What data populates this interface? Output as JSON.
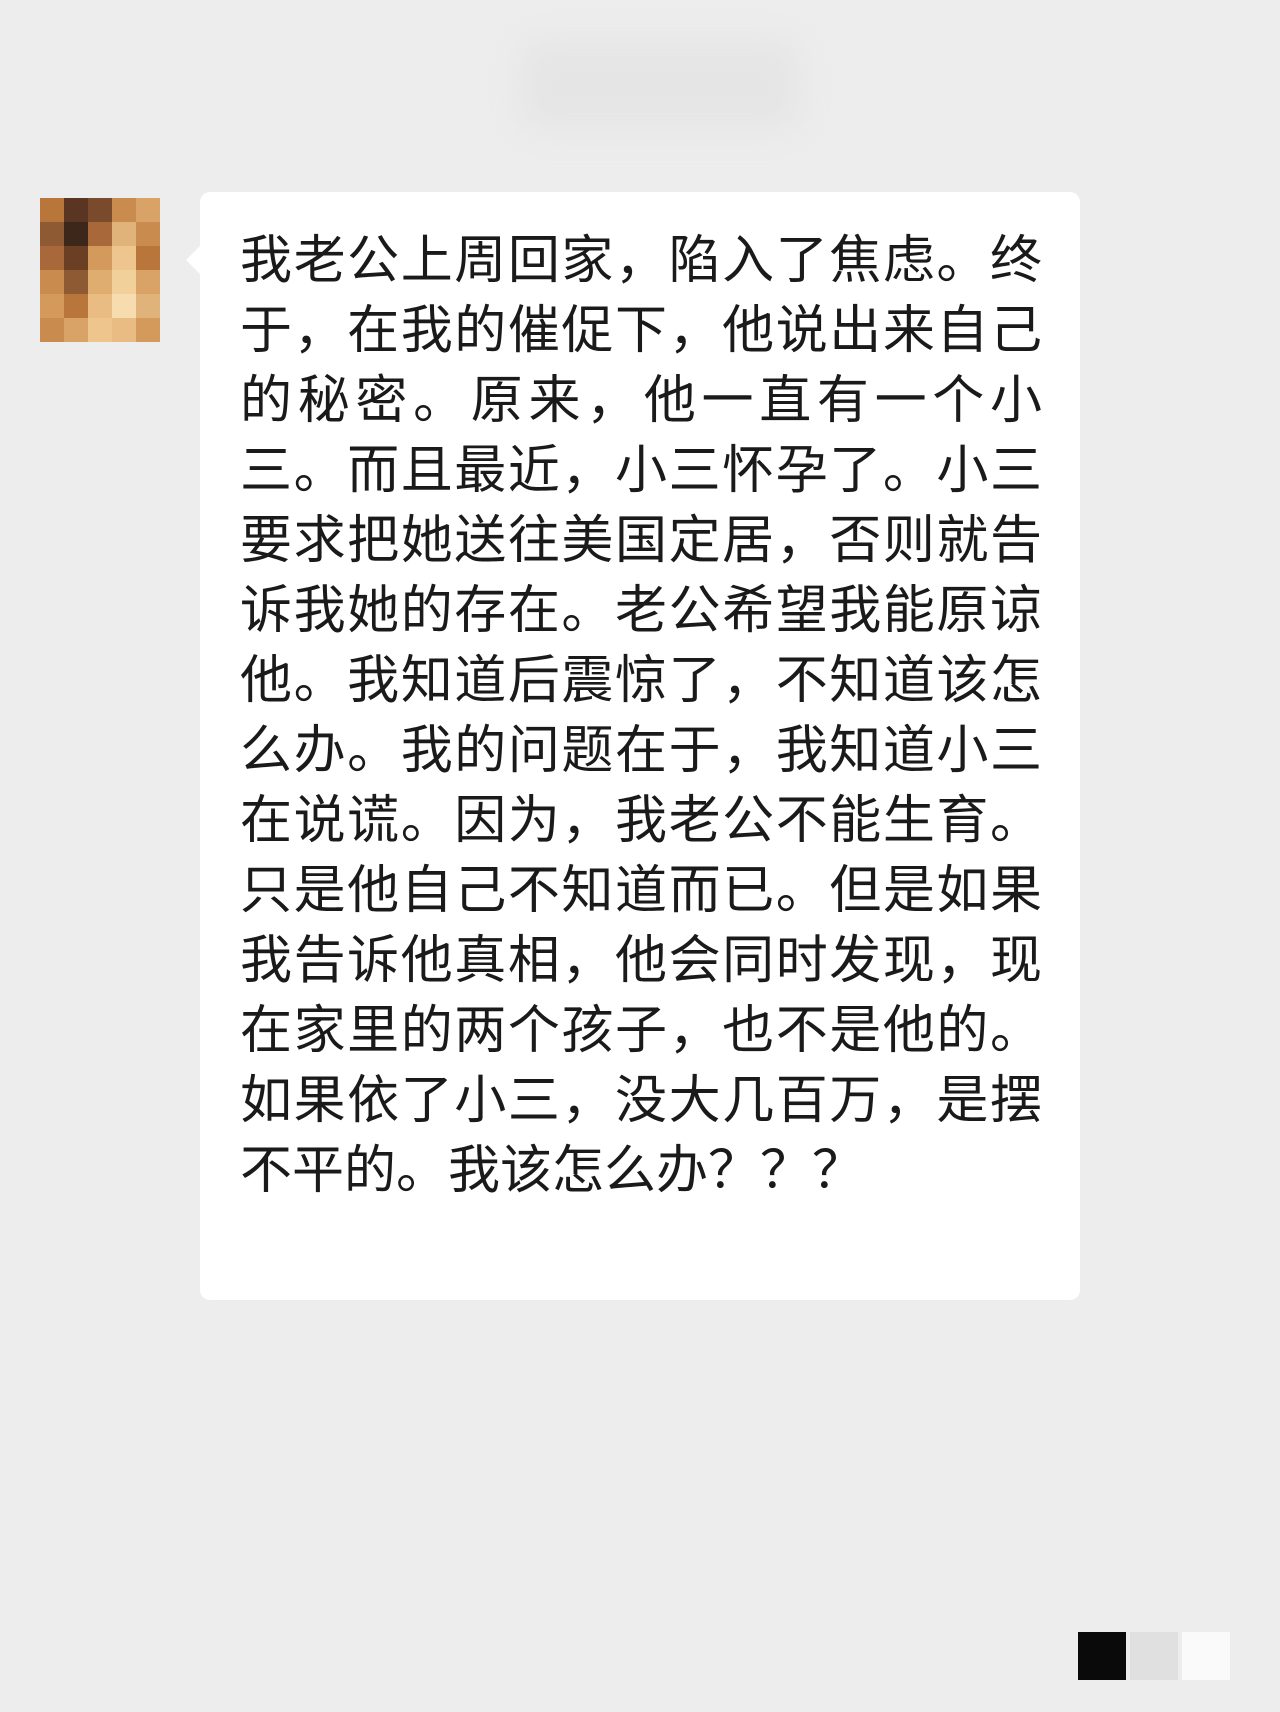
{
  "chat": {
    "message": "我老公上周回家，陷入了焦虑。终于，在我的催促下，他说出来自己的秘密。原来，他一直有一个小三。而且最近，小三怀孕了。小三要求把她送往美国定居，否则就告诉我她的存在。老公希望我能原谅他。我知道后震惊了，不知道该怎么办。我的问题在于，我知道小三在说谎。因为，我老公不能生育。只是他自己不知道而已。但是如果我告诉他真相，他会同时发现，现在家里的两个孩子，也不是他的。如果依了小三，没大几百万，是摆不平的。我该怎么办？？？"
  },
  "avatar": {
    "style": "pixelated",
    "colors": [
      "#b9763a",
      "#5a3522",
      "#7a4a2c",
      "#c98b4e",
      "#d9a267",
      "#8e5a34",
      "#3d261a",
      "#a8683a",
      "#e0b37a",
      "#c98b4e",
      "#a8683a",
      "#6b3f24",
      "#d49a5c",
      "#efc58e",
      "#b9763a",
      "#c98b4e",
      "#8e5a34",
      "#e0ad70",
      "#f2d09a",
      "#d9a267",
      "#d49a5c",
      "#b9763a",
      "#e8bc82",
      "#f6dcae",
      "#e0b37a",
      "#c98b4e",
      "#d9a267",
      "#efc58e",
      "#e8bc82",
      "#d49a5c"
    ]
  },
  "corner_squares": [
    "#0a0a0a",
    "#e0e0e0",
    "#fafafa"
  ]
}
